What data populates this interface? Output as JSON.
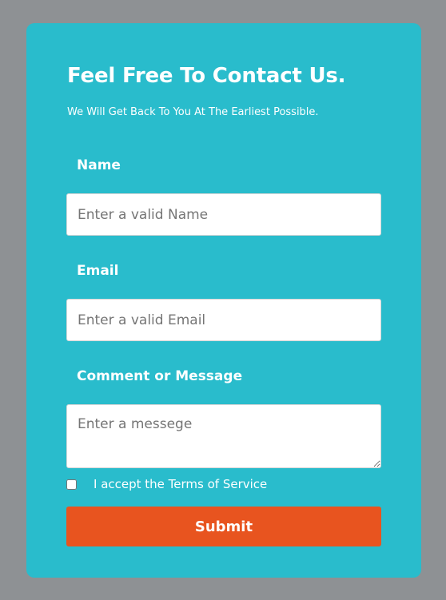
{
  "form": {
    "title": "Feel Free To Contact Us.",
    "subtitle": "We Will Get Back To You At The Earliest Possible.",
    "name_label": "Name",
    "name_placeholder": "Enter a valid Name",
    "email_label": "Email",
    "email_placeholder": "Enter a valid Email",
    "message_label": "Comment or Message",
    "message_placeholder": "Enter a messege",
    "terms_text": "I accept the Terms of Service",
    "submit_label": "Submit"
  },
  "colors": {
    "page_background": "#8e9194",
    "card_background": "#29bccc",
    "submit_button": "#e8541f"
  }
}
